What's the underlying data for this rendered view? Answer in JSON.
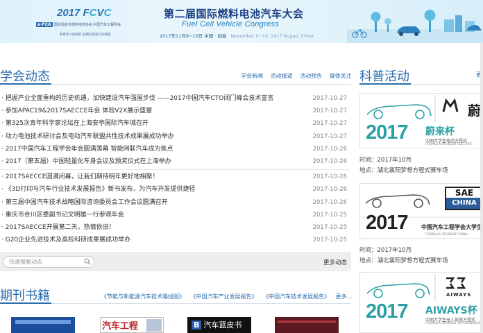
{
  "banner": {
    "year_a": "2017 F",
    "year_b": "C",
    "year_c": "V",
    "year_d": "C",
    "org_tag": "e-FCA",
    "org_line": "国际氢能与燃料电池协会  中国汽车工程学会",
    "org_line2": "如皋市人民政府  氢燃料电池汽车联盟",
    "title": "第二届国际燃料电池汽车大会",
    "subtitle": "Fuel Cell Vehicle Congress",
    "date_cn": "2017年11月9−10日  中国 · 如皋",
    "date_en": "November 9−10, 2017 Rugao, China"
  },
  "news": {
    "title": "学会动态",
    "tabs": [
      "学会新闻",
      "活动报道",
      "活动预告",
      "媒体关注"
    ],
    "items": [
      {
        "title": "· 把握产业全面重构的历史机遇，加快建设汽车强国步伐 ——2017中国汽车CTO闭门峰会技术宣言",
        "date": "2017-10-27"
      },
      {
        "title": "· 参加APAC19&2017SAECCE年会 体验V2X展示盛宴",
        "date": "2017-10-27"
      },
      {
        "title": "· 第325次青年科学家论坛在上海安亭国际汽车城召开",
        "date": "2017-10-27"
      },
      {
        "title": "· 动力电池技术研讨会及电动汽车联盟共性技术成果展成功举办",
        "date": "2017-10-27"
      },
      {
        "title": "· 2017中国汽车工程学会年会圆满落幕 智能网联汽车成为焦点",
        "date": "2017-10-26"
      },
      {
        "title": "· 2017（第五届）中国轻量化车身会议及颁奖仪式在上海举办",
        "date": "2017-10-26"
      },
      {
        "title": "· 2017SAECCE圆满闭幕，让我们期待明年更好地相聚！",
        "date": "2017-10-26"
      },
      {
        "title": "· 《3D打印与汽车行业技术发展报告》新书发布，为汽车开发提供捷径",
        "date": "2017-10-26"
      },
      {
        "title": "· 第三届中国汽车技术战略国际咨询委员会工作会议圆满召开",
        "date": "2017-10-26"
      },
      {
        "title": "· 重庆市合川区委副书记文明雄一行参观年会",
        "date": "2017-10-25"
      },
      {
        "title": "· 2017SAECCE开展第二天，热情依旧！",
        "date": "2017-10-25"
      },
      {
        "title": "· G20企业先进技术及高校科研成果展成功举办",
        "date": "2017-10-25"
      }
    ],
    "search_placeholder": "快速搜索动态",
    "more": "更多动态"
  },
  "publications": {
    "title": "期刊书籍",
    "links": [
      "《节能与新能源汽车技术路线图》",
      "《中国汽车产业发展报告》",
      "《中国汽车技术发展报告》",
      "更多..."
    ],
    "book2_title": "汽车工程",
    "book3_letter": "B",
    "book3_title": "汽车蓝皮书"
  },
  "science": {
    "title": "科普活动",
    "more": "更",
    "cards": [
      {
        "year": "2017",
        "cup": "蔚来杯",
        "brand": "蔚",
        "sub": "中国大学生电动方程式",
        "sub_en": "FORMULA STUDENT ELECTRIC",
        "time": "时间：2017年10月",
        "place": "地点：湖北襄阳梦想方程式赛车场"
      },
      {
        "year": "2017",
        "cup": "中国汽车工程学会大学生",
        "brand_top": "SAE",
        "brand_bottom": "CHINA",
        "sub_en": "FORMULA STUDENT CHINA",
        "time": "时间：2017年10月",
        "place": "地点：湖北襄阳梦想方程式赛车场"
      },
      {
        "year": "2017",
        "cup": "AIWAYS杯",
        "brand": "AIWAYS",
        "sub": "中国大学生无人驾驶方程式",
        "sub_en": "FORMULA STUDENT AUTONOMOUS"
      }
    ]
  },
  "colors": {
    "accent": "#2b6cae",
    "teal": "#2aa0a6",
    "banner_title": "#1c3f82"
  }
}
